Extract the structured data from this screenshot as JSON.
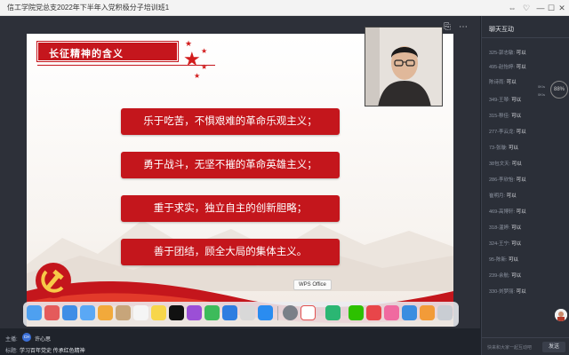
{
  "window": {
    "title": "信工学院党总支2022年下半年入党积极分子培训班1",
    "controls": [
      "⇔",
      "♡",
      "—",
      "☐",
      "✕"
    ]
  },
  "slide": {
    "header": "长征精神的含义",
    "bullets": [
      "乐于吃苦，不惧艰难的革命乐观主义；",
      "勇于战斗，无坚不摧的革命英雄主义；",
      "重于求实，独立自主的创新胆略；",
      "善于团结，顾全大局的集体主义。"
    ],
    "accent": "#c4161c"
  },
  "dock": {
    "tooltip": "WPS Office",
    "icons": [
      "finder-icon",
      "launchpad-icon",
      "safari-icon",
      "mail-icon",
      "photos-icon",
      "contacts-icon",
      "reminders-icon",
      "notes-icon",
      "appletv-icon",
      "podcasts-icon",
      "numbers-icon",
      "keynote-icon",
      "screenshot-icon",
      "appstore-icon",
      "system-prefs-icon",
      "wps-icon",
      "infuse-icon",
      "wechat-icon",
      "app-red-icon",
      "app-pink-icon",
      "app-blue-icon",
      "app-orange-icon",
      "trash-icon"
    ]
  },
  "status": {
    "host_label": "主播:",
    "host_initials": "CH",
    "host_name": "许心思",
    "topic_label": "标题:",
    "topic": "学习百年党史 传承红色精神"
  },
  "chat": {
    "title": "聊天互动",
    "gauge": "88%",
    "speed_up": "0K/s",
    "speed_down": "0K/s",
    "messages": [
      {
        "user": "325-郭志敏:",
        "text": "可以"
      },
      {
        "user": "495-赵怡婷:",
        "text": "可以"
      },
      {
        "user": "陈诗雨:",
        "text": "可以"
      },
      {
        "user": "349-王琴:",
        "text": "可以"
      },
      {
        "user": "315-穆佳:",
        "text": "可以"
      },
      {
        "user": "277-李云龙:",
        "text": "可以"
      },
      {
        "user": "73-张璇:",
        "text": "可以"
      },
      {
        "user": "38包文天:",
        "text": "可以"
      },
      {
        "user": "286-李欣怡:",
        "text": "可以"
      },
      {
        "user": "崔明月:",
        "text": "可以"
      },
      {
        "user": "469-高博轩:",
        "text": "可以"
      },
      {
        "user": "318-温婷:",
        "text": "可以"
      },
      {
        "user": "324-王宁:",
        "text": "可以"
      },
      {
        "user": "95-陈新:",
        "text": "可以"
      },
      {
        "user": "239-余航:",
        "text": "可以"
      },
      {
        "user": "330-刘梦丽:",
        "text": "可以"
      }
    ],
    "input_placeholder": "快来和大家一起互动吧",
    "send_label": "发送"
  }
}
